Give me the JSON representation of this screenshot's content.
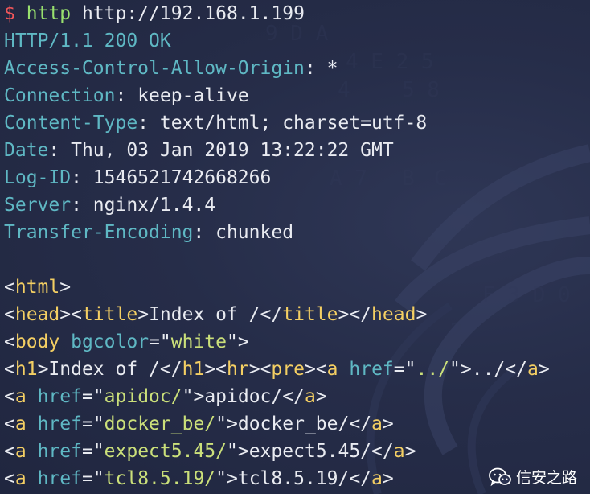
{
  "command": {
    "prompt": "$",
    "program": "http",
    "argument": "http://192.168.1.199"
  },
  "status_line": "HTTP/1.1 200 OK",
  "headers": [
    {
      "key": "Access-Control-Allow-Origin",
      "value": "*"
    },
    {
      "key": "Connection",
      "value": "keep-alive"
    },
    {
      "key": "Content-Type",
      "value": "text/html; charset=utf-8"
    },
    {
      "key": "Date",
      "value": "Thu, 03 Jan 2019 13:22:22 GMT"
    },
    {
      "key": "Log-ID",
      "value": "1546521742668266"
    },
    {
      "key": "Server",
      "value": "nginx/1.4.4"
    },
    {
      "key": "Transfer-Encoding",
      "value": "chunked"
    }
  ],
  "body": {
    "html_open": "html",
    "head_tag": "head",
    "title_tag": "title",
    "page_title": "Index of /",
    "body_tag": "body",
    "body_attr": "bgcolor",
    "body_attr_value": "white",
    "h1_tag": "h1",
    "h1_text": "Index of /",
    "hr_tag": "hr",
    "pre_tag": "pre",
    "a_tag": "a",
    "href_attr": "href",
    "links": [
      {
        "href": "../",
        "text": "../"
      },
      {
        "href": "apidoc/",
        "text": "apidoc/"
      },
      {
        "href": "docker_be/",
        "text": "docker_be/"
      },
      {
        "href": "expect5.45/",
        "text": "expect5.45/"
      },
      {
        "href": "tcl8.5.19/",
        "text": "tcl8.5.19/"
      }
    ]
  },
  "watermark": {
    "icon": "wechat-icon",
    "text": "信安之路"
  },
  "colors": {
    "background": "#262d49",
    "header_key": "#5fb8c4",
    "tag": "#f4cf63",
    "attr_value": "#cbe07a",
    "prompt": "#f0565a",
    "command": "#98e06e",
    "text": "#e9ebf1"
  }
}
